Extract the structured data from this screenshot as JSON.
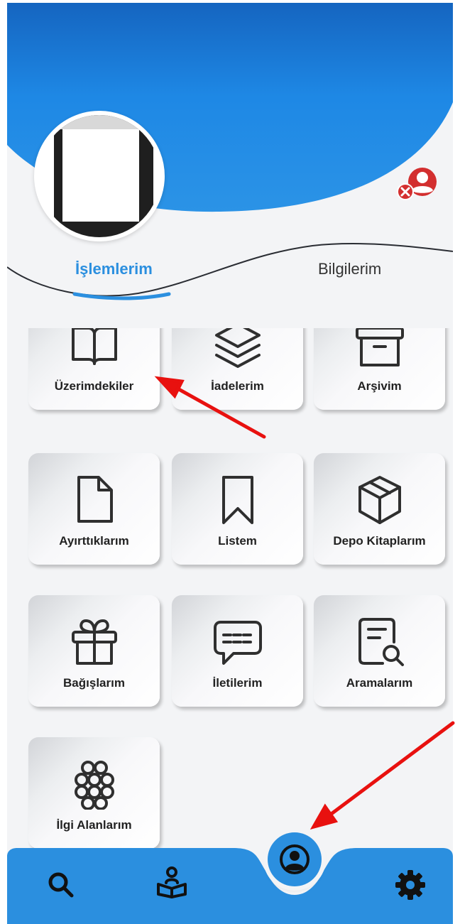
{
  "tabs": [
    {
      "label": "İşlemlerim",
      "active": true
    },
    {
      "label": "Bilgilerim",
      "active": false
    }
  ],
  "menu": [
    {
      "label": "Üzerimdekiler",
      "icon": "book-open-icon"
    },
    {
      "label": "İadelerim",
      "icon": "layers-icon"
    },
    {
      "label": "Arşivim",
      "icon": "archive-box-icon"
    },
    {
      "label": "Ayırttıklarım",
      "icon": "document-icon"
    },
    {
      "label": "Listem",
      "icon": "bookmark-icon"
    },
    {
      "label": "Depo Kitaplarım",
      "icon": "package-icon"
    },
    {
      "label": "Bağışlarım",
      "icon": "gift-icon"
    },
    {
      "label": "İletilerim",
      "icon": "message-icon"
    },
    {
      "label": "Aramalarım",
      "icon": "document-search-icon"
    },
    {
      "label": "İlgi Alanlarım",
      "icon": "circles-cluster-icon"
    }
  ],
  "bottom_nav": [
    {
      "icon": "search-icon"
    },
    {
      "icon": "reader-icon"
    },
    {
      "icon": "user-circle-icon",
      "active": true
    },
    {
      "icon": "gear-icon"
    }
  ],
  "colors": {
    "accent": "#2b8fdf",
    "header_dark": "#1976d2",
    "logout": "#d32f2f",
    "arrow": "#e8110f"
  }
}
